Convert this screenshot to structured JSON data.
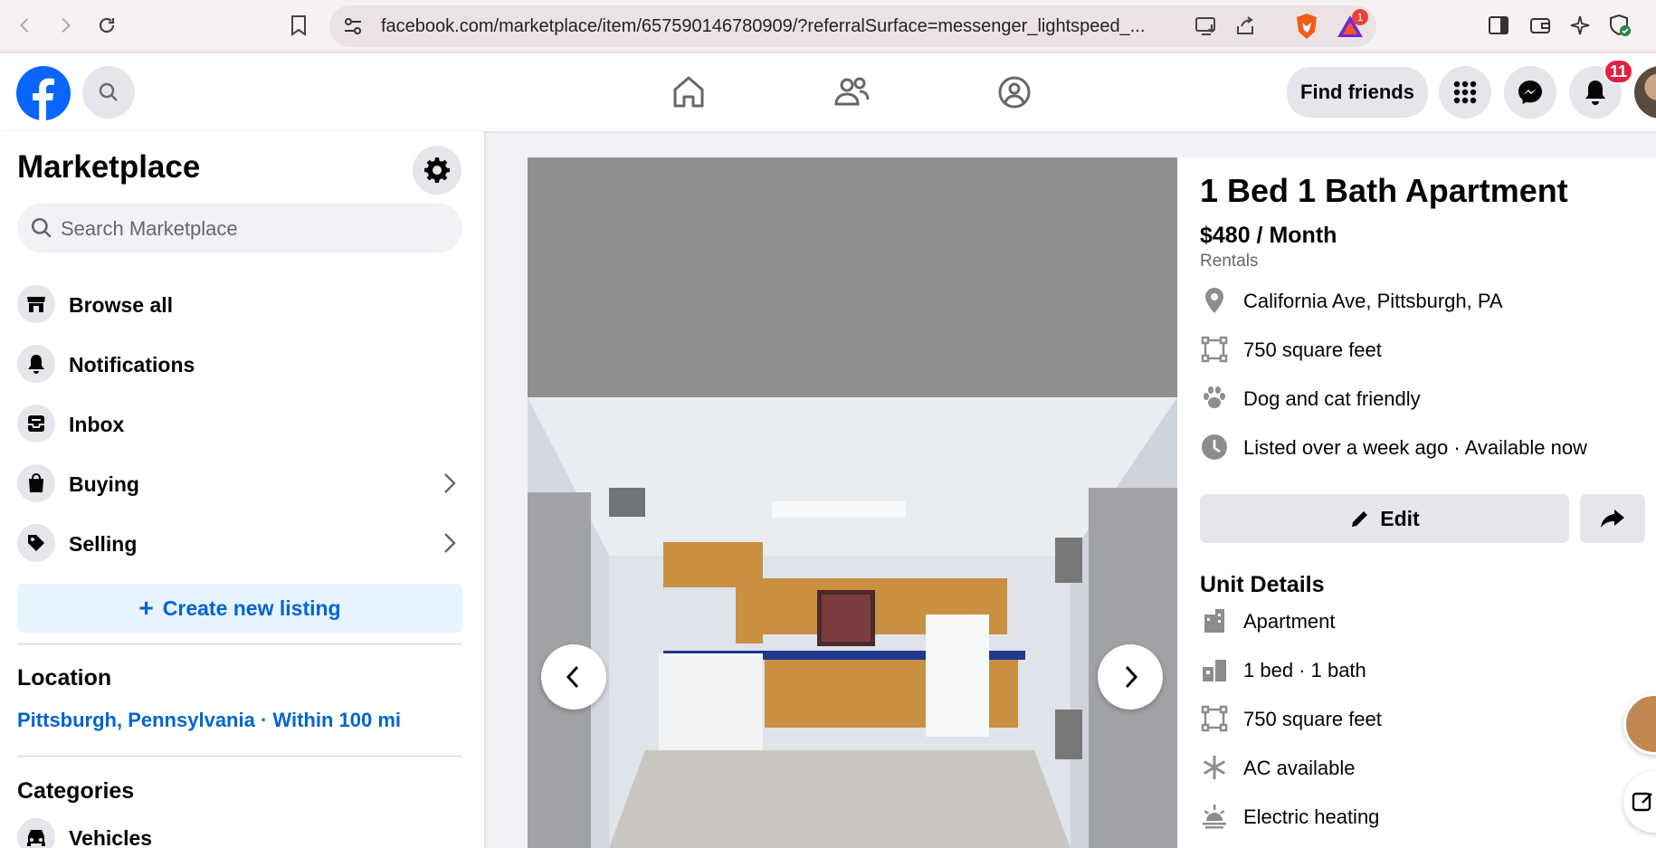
{
  "browser": {
    "url": "facebook.com/marketplace/item/657590146780909/?referralSurface=messenger_lightspeed_...",
    "brave_badge": "1"
  },
  "topbar": {
    "find_friends": "Find friends",
    "notif_count": "11"
  },
  "sidebar": {
    "title": "Marketplace",
    "search_placeholder": "Search Marketplace",
    "items": [
      {
        "label": "Browse all"
      },
      {
        "label": "Notifications"
      },
      {
        "label": "Inbox"
      },
      {
        "label": "Buying"
      },
      {
        "label": "Selling"
      }
    ],
    "create_label": "Create new listing",
    "location_title": "Location",
    "location_value": "Pittsburgh, Pennsylvania · Within 100 mi",
    "categories_title": "Categories",
    "categories": [
      {
        "label": "Vehicles"
      }
    ]
  },
  "listing": {
    "title": "1 Bed 1 Bath Apartment",
    "price": "$480 / Month",
    "category": "Rentals",
    "facts": [
      {
        "icon": "location-pin-icon",
        "text": "California Ave, Pittsburgh, PA"
      },
      {
        "icon": "square-feet-icon",
        "text": "750 square feet"
      },
      {
        "icon": "paw-icon",
        "text": "Dog and cat friendly"
      },
      {
        "icon": "clock-icon",
        "text": "Listed over a week ago · Available now"
      }
    ],
    "edit_label": "Edit",
    "unit_details_title": "Unit Details",
    "unit_details": [
      {
        "icon": "building-icon",
        "text": "Apartment"
      },
      {
        "icon": "rooms-icon",
        "text": "1 bed · 1 bath"
      },
      {
        "icon": "square-feet-icon",
        "text": "750 square feet"
      },
      {
        "icon": "snowflake-icon",
        "text": "AC available"
      },
      {
        "icon": "heating-icon",
        "text": "Electric heating"
      }
    ]
  },
  "colors": {
    "brand_blue": "#0866ff",
    "link_blue": "#0064d1",
    "notif_red": "#e41e3f"
  }
}
